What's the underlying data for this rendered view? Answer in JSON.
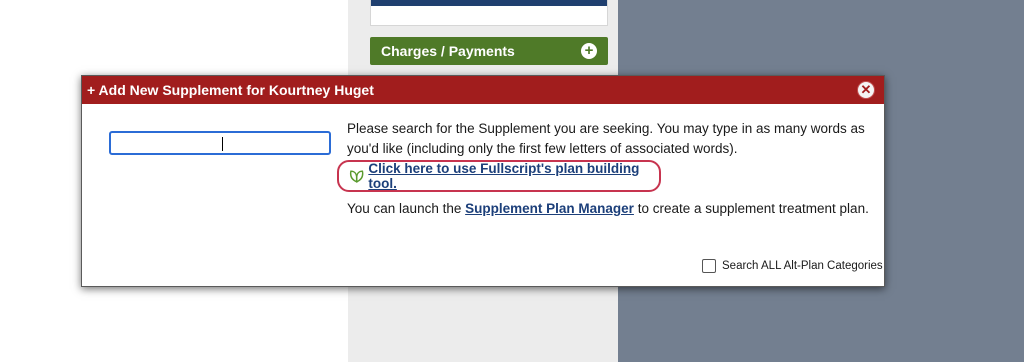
{
  "background": {
    "panel_charges_label": "Charges / Payments"
  },
  "modal": {
    "title": "+ Add New Supplement for Kourtney Huget",
    "close_icon": "close-icon",
    "search_value": "",
    "description": "Please search for the Supplement you are seeking. You may type in as many words as you'd like (including only the first few letters of associated words).",
    "fullscript_link": "Click here to use Fullscript's plan building tool.",
    "launch_prefix": "You can launch the",
    "launch_link": "Supplement Plan Manager",
    "launch_suffix": "to create a supplement treatment plan.",
    "alt_plan_label": "Search ALL Alt-Plan Categories",
    "alt_plan_checked": false
  },
  "colors": {
    "header_red": "#a11d1d",
    "link_blue": "#1c3f7a",
    "charges_green": "#4f7a28",
    "highlight_ring": "#c7344f"
  }
}
